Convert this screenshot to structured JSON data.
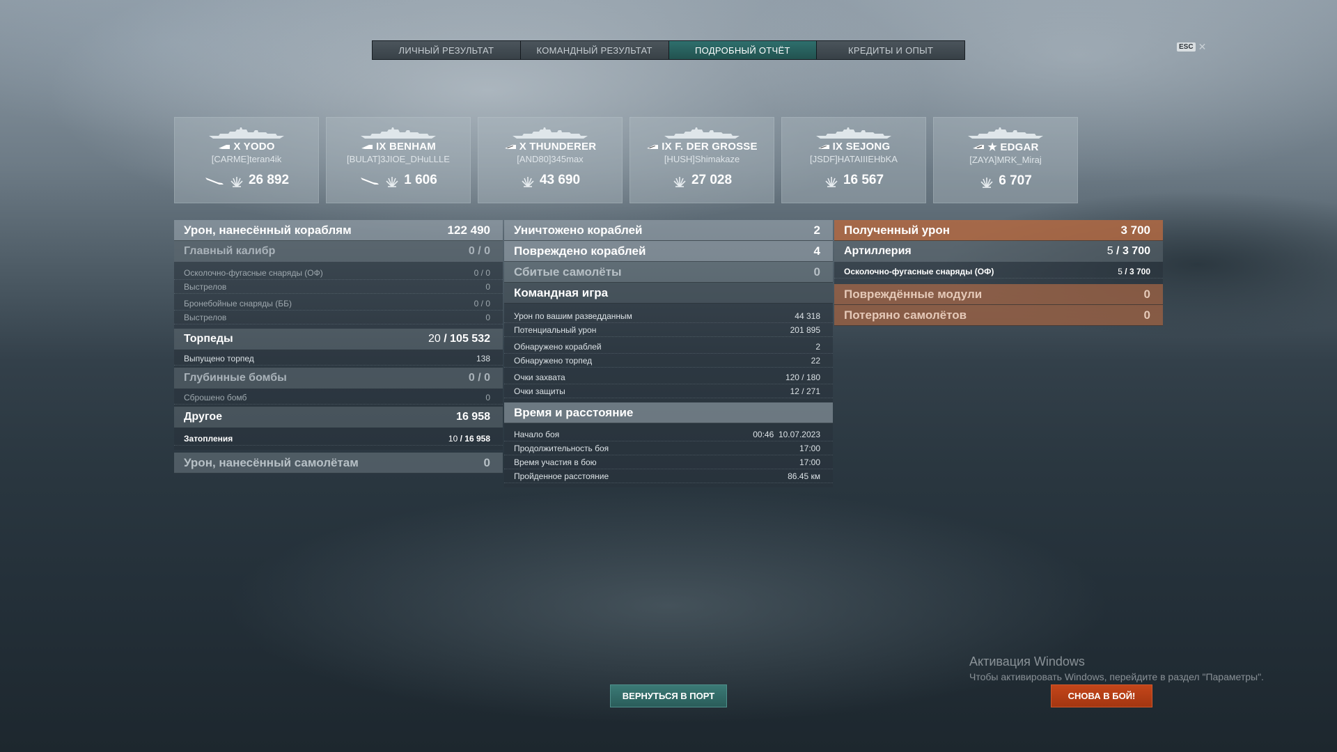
{
  "tabs": [
    {
      "label": "ЛИЧНЫЙ РЕЗУЛЬТАТ",
      "active": false
    },
    {
      "label": "КОМАНДНЫЙ РЕЗУЛЬТАТ",
      "active": false
    },
    {
      "label": "ПОДРОБНЫЙ ОТЧЁТ",
      "active": true
    },
    {
      "label": "КРЕДИТЫ И ОПЫТ",
      "active": false
    }
  ],
  "esc": {
    "key": "ESC",
    "close": "✕"
  },
  "ships": [
    {
      "name": "X YODO",
      "player": "[CARME]teran4ik",
      "damage": "26 892",
      "class_icon": "destroyer-icon",
      "torpedo": true
    },
    {
      "name": "IX BENHAM",
      "player": "[BULAT]3JIOE_DHuLLLE",
      "damage": "1 606",
      "class_icon": "destroyer-icon",
      "torpedo": true
    },
    {
      "name": "X THUNDERER",
      "player": "[AND80]345max",
      "damage": "43 690",
      "class_icon": "battleship-icon",
      "torpedo": false
    },
    {
      "name": "IX F. DER GROSSE",
      "player": "[HUSH]Shimakaze",
      "damage": "27 028",
      "class_icon": "battleship-icon",
      "torpedo": false
    },
    {
      "name": "IX SEJONG",
      "player": "[JSDF]HATAIIIEHbKA",
      "damage": "16 567",
      "class_icon": "battleship-icon",
      "torpedo": false
    },
    {
      "name": "★ EDGAR",
      "player": "[ZAYA]MRK_Miraj",
      "damage": "6 707",
      "class_icon": "cruiser-icon",
      "torpedo": false
    }
  ],
  "left": {
    "damage_ships": {
      "label": "Урон, нанесённый кораблям",
      "value": "122 490"
    },
    "main_caliber": {
      "label": "Главный калибр",
      "value": "0 / 0"
    },
    "he_shells": {
      "label": "Осколочно-фугасные снаряды (ОФ)",
      "value": "0 / 0"
    },
    "he_shots": {
      "label": "Выстрелов",
      "value": "0"
    },
    "ap_shells": {
      "label": "Бронебойные снаряды (ББ)",
      "value": "0 / 0"
    },
    "ap_shots": {
      "label": "Выстрелов",
      "value": "0"
    },
    "torpedoes": {
      "label": "Торпеды",
      "hits": "20",
      "damage": "105 532"
    },
    "torpedoes_launched": {
      "label": "Выпущено торпед",
      "value": "138"
    },
    "depth_charges": {
      "label": "Глубинные бомбы",
      "value": "0 / 0"
    },
    "bombs_dropped": {
      "label": "Сброшено бомб",
      "value": "0"
    },
    "other": {
      "label": "Другое",
      "value": "16 958"
    },
    "flooding": {
      "label": "Затопления",
      "count": "10",
      "damage": "16 958"
    },
    "damage_planes": {
      "label": "Урон, нанесённый самолётам",
      "value": "0"
    }
  },
  "mid": {
    "destroyed": {
      "label": "Уничтожено кораблей",
      "value": "2"
    },
    "damaged": {
      "label": "Повреждено кораблей",
      "value": "4"
    },
    "planes_shot": {
      "label": "Сбитые самолёты",
      "value": "0"
    },
    "team_play": {
      "label": "Командная игра"
    },
    "spotting_damage": {
      "label": "Урон по вашим разведданным",
      "value": "44 318"
    },
    "potential_damage": {
      "label": "Потенциальный урон",
      "value": "201 895"
    },
    "ships_spotted": {
      "label": "Обнаружено кораблей",
      "value": "2"
    },
    "torpedoes_spotted": {
      "label": "Обнаружено торпед",
      "value": "22"
    },
    "capture_points": {
      "label": "Очки захвата",
      "value": "120 / 180"
    },
    "defense_points": {
      "label": "Очки защиты",
      "value": "12 / 271"
    },
    "time_distance": {
      "label": "Время и расстояние"
    },
    "battle_start": {
      "label": "Начало боя",
      "time": "00:46",
      "date": "10.07.2023"
    },
    "battle_duration": {
      "label": "Продолжительность боя",
      "value": "17:00"
    },
    "participation_time": {
      "label": "Время участия в бою",
      "value": "17:00"
    },
    "distance": {
      "label": "Пройденное расстояние",
      "value": "86.45 км"
    }
  },
  "right": {
    "received_damage": {
      "label": "Полученный урон",
      "value": "3 700"
    },
    "artillery": {
      "label": "Артиллерия",
      "hits": "5",
      "damage": "3 700"
    },
    "he_received": {
      "label": "Осколочно-фугасные снаряды (ОФ)",
      "hits": "5",
      "damage": "3 700"
    },
    "damaged_modules": {
      "label": "Повреждённые модули",
      "value": "0"
    },
    "planes_lost": {
      "label": "Потеряно самолётов",
      "value": "0"
    }
  },
  "buttons": {
    "port": "ВЕРНУТЬСЯ В ПОРТ",
    "battle": "СНОВА В БОЙ!"
  },
  "windows": {
    "title": "Активация Windows",
    "subtitle": "Чтобы активировать Windows, перейдите в раздел \"Параметры\"."
  },
  "colors": {
    "accent_teal": "#2e6f6d",
    "accent_orange": "#b26842",
    "battle_button": "#c4461a"
  }
}
